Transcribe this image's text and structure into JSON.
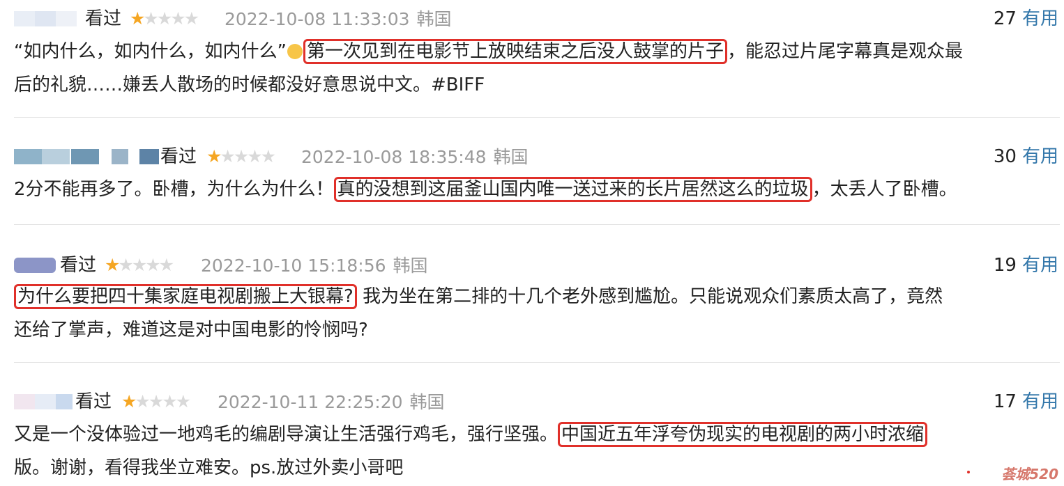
{
  "reviews": [
    {
      "status": "看过",
      "stars": "★",
      "stars_off": "★★★★",
      "time": "2022-10-08 11:33:03",
      "region": "韩国",
      "votes": "27",
      "useful": "有用",
      "line1_pre": "“如内什么，如内什么，如内什么”",
      "line1_hl": "第一次见到在电影节上放映结束之后没人鼓掌的片子",
      "line1_post": "，能忍过片尾字幕真是观众最",
      "line2": "后的礼貌……嫌丢人散场的时候都没好意思说中文。#BIFF"
    },
    {
      "status": "看过",
      "stars": "★",
      "stars_off": "★★★★",
      "time": "2022-10-08 18:35:48",
      "region": "韩国",
      "votes": "30",
      "useful": "有用",
      "line1_pre": "2分不能再多了。卧槽，为什么为什么！",
      "line1_hl": "真的没想到这届釜山国内唯一送过来的长片居然这么的垃圾",
      "line1_post": "，太丢人了卧槽。"
    },
    {
      "status": "看过",
      "stars": "★",
      "stars_off": "★★★★",
      "time": "2022-10-10 15:18:56",
      "region": "韩国",
      "votes": "19",
      "useful": "有用",
      "line1_hl": "为什么要把四十集家庭电视剧搬上大银幕?",
      "line1_post": " 我为坐在第二排的十几个老外感到尴尬。只能说观众们素质太高了，竟然",
      "line2": "还给了掌声，难道这是对中国电影的怜悯吗?"
    },
    {
      "status": "看过",
      "stars": "★",
      "stars_off": "★★★★",
      "time": "2022-10-11 22:25:20",
      "region": "韩国",
      "votes": "17",
      "useful": "有用",
      "line1_pre": "又是一个没体验过一地鸡毛的编剧导演让生活强行鸡毛，强行坚强。",
      "line1_hl": "中国近五年浮夸伪现实的电视剧的两小时浓缩",
      "line2": "版。谢谢，看得我坐立难安。ps.放过外卖小哥吧"
    }
  ],
  "watermark": "荟城520"
}
